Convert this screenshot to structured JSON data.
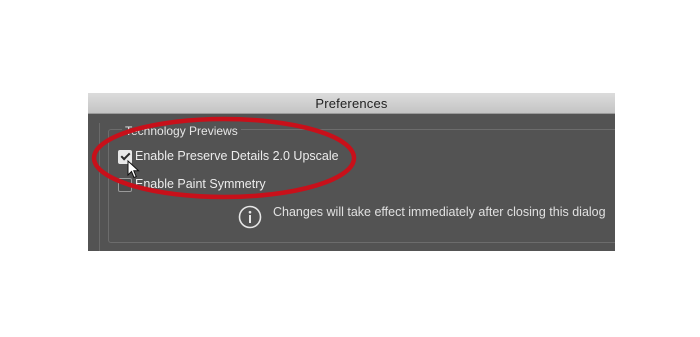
{
  "dialog": {
    "title": "Preferences",
    "group_label": "Technology Previews",
    "options": [
      {
        "label": "Enable Preserve Details 2.0 Upscale",
        "checked": true
      },
      {
        "label": "Enable Paint Symmetry",
        "checked": false
      }
    ],
    "info_icon": "info-icon",
    "info_text": "Changes will take effect immediately after closing this dialog"
  },
  "annotation": {
    "highlight_color": "#c8101a"
  },
  "colors": {
    "panel": "#535353",
    "titlebar": "#d4d4d4"
  }
}
